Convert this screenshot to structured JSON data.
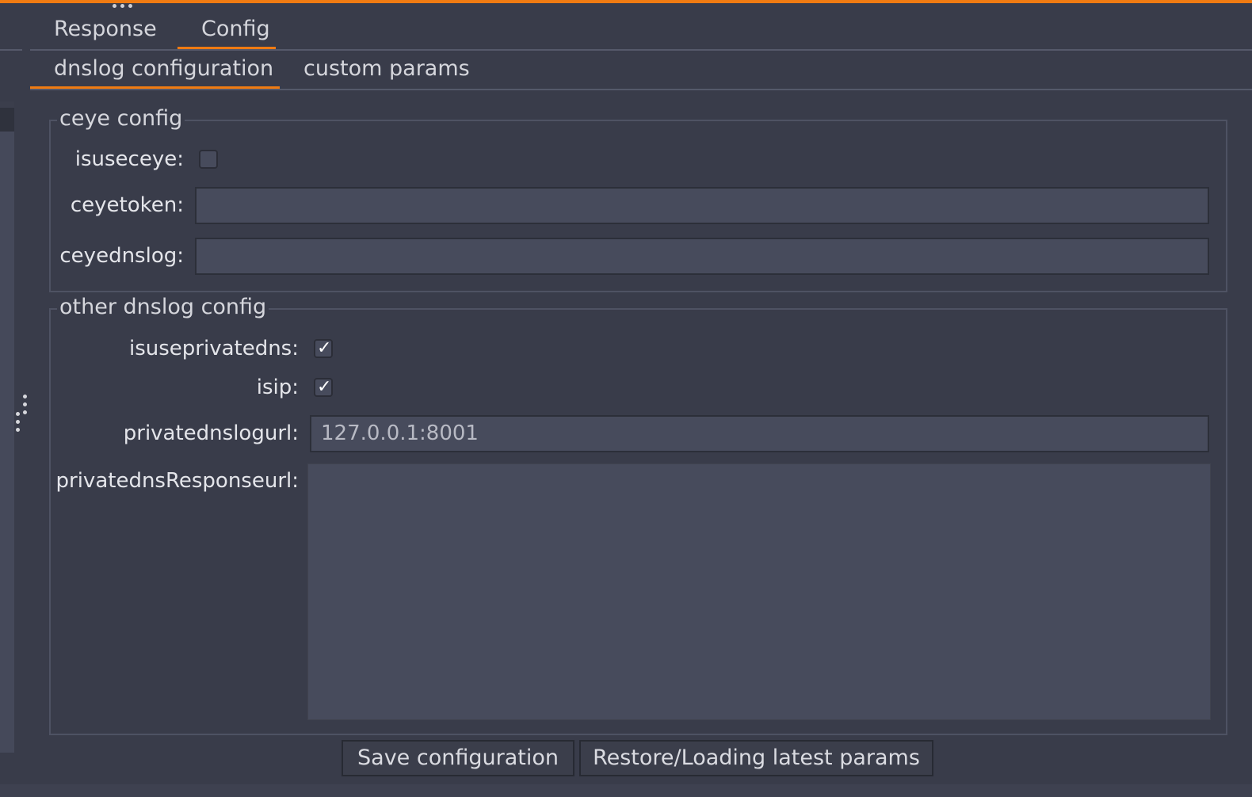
{
  "main_tabs": [
    {
      "label": "Response",
      "active": false
    },
    {
      "label": "Config",
      "active": true
    }
  ],
  "sub_tabs": [
    {
      "label": "dnslog configuration",
      "active": true
    },
    {
      "label": "custom params",
      "active": false
    }
  ],
  "ceye_config": {
    "legend": "ceye config",
    "isuseceye": {
      "label": "isuseceye:",
      "checked": false
    },
    "ceyetoken": {
      "label": "ceyetoken:",
      "value": ""
    },
    "ceyednslog": {
      "label": "ceyednslog:",
      "value": ""
    }
  },
  "other_config": {
    "legend": "other dnslog config",
    "isuseprivatedns": {
      "label": "isuseprivatedns:",
      "checked": true
    },
    "isip": {
      "label": "isip:",
      "checked": true
    },
    "privatednslogurl": {
      "label": "privatednslogurl:",
      "value": "127.0.0.1:8001"
    },
    "privatednsResponseurl": {
      "label": "privatednsResponseurl:",
      "value": ""
    }
  },
  "buttons": {
    "save": "Save configuration",
    "restore": "Restore/Loading latest params"
  },
  "colors": {
    "accent": "#f07b12",
    "background": "#393c4a",
    "field": "#474b5c"
  }
}
